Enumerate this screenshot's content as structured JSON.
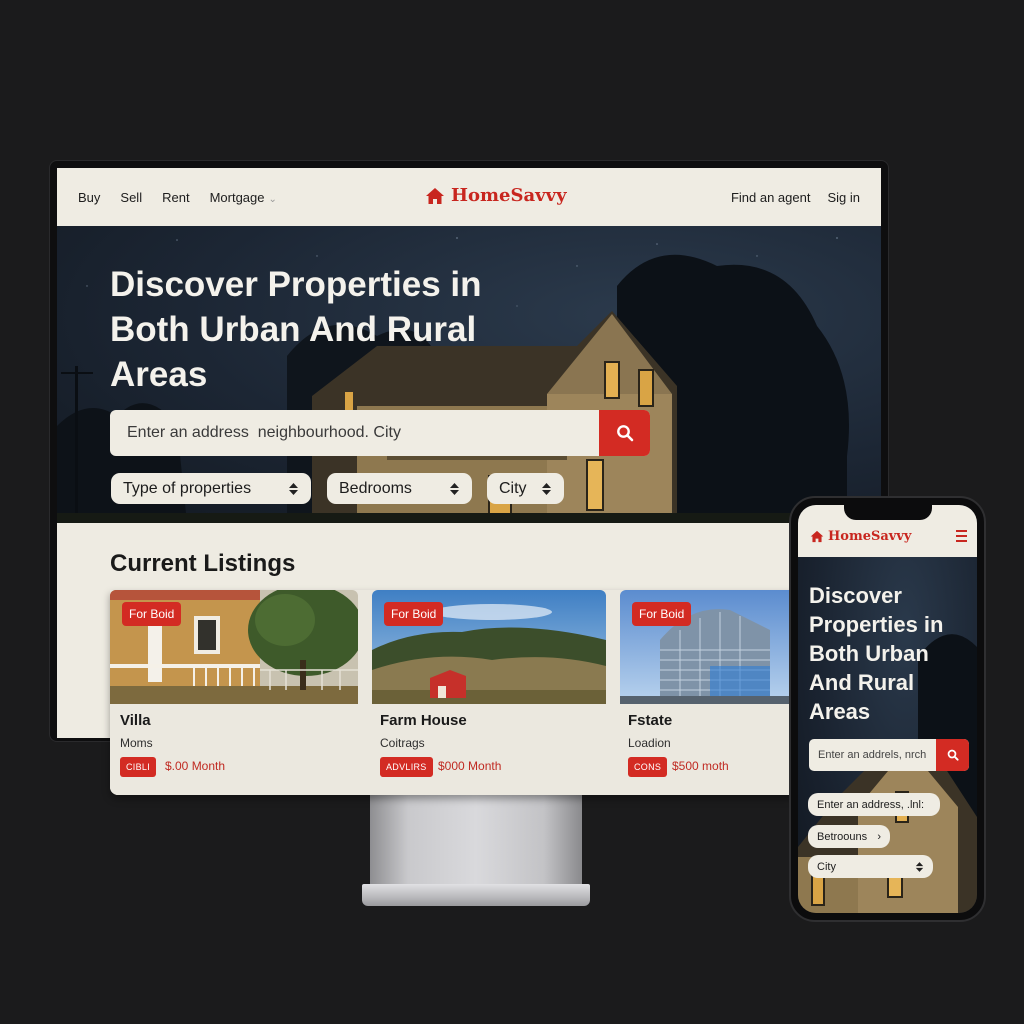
{
  "brand": {
    "name": "HomeSavvy",
    "color": "#c8261f"
  },
  "nav": {
    "left_items": [
      "Buy",
      "Sell",
      "Rent",
      "Mortgage"
    ],
    "find_agent": "Find an agent",
    "sign_in": "Sig in"
  },
  "hero": {
    "title": "Discover Properties in Both Urban And Rural Areas",
    "search_placeholder": "Enter an address  neighbourhood. City",
    "filters": [
      "Type of properties",
      "Bedrooms",
      "City"
    ]
  },
  "listings": {
    "title": "Current Listings",
    "cards": [
      {
        "badge": "For Boid",
        "title": "Villa",
        "subtitle": "Moms",
        "tag": "CIBLI",
        "price": "$.00 Month"
      },
      {
        "badge": "For Boid",
        "title": "Farm House",
        "subtitle": "Coitrags",
        "tag": "ADVLIRS",
        "price": "$000 Month"
      },
      {
        "badge": "For Boid",
        "title": "Fstate",
        "subtitle": "Loadion",
        "tag": "CONS",
        "price": "$500 moth"
      }
    ]
  },
  "phone": {
    "logo": "HomeSavvy",
    "title": "Discover Properties in Both Urban And Rural Areas",
    "search_placeholder": "Enter an addrels, nrch",
    "pills": [
      "Enter an address, .lnl:",
      "Betroouns",
      "City"
    ]
  },
  "colors": {
    "accent": "#d32b23",
    "panel": "#efece3",
    "background": "#1b1b1c"
  }
}
